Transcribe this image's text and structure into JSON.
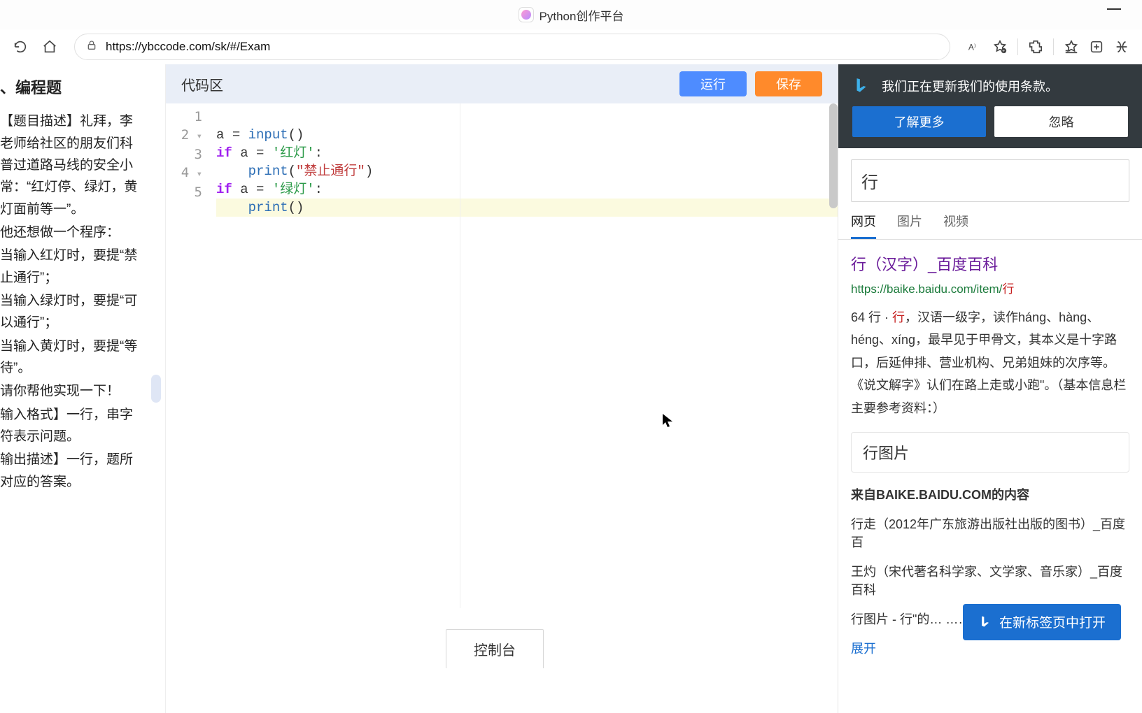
{
  "window": {
    "title": "Python创作平台"
  },
  "toolbar": {
    "url": "https://ybccode.com/sk/#/Exam"
  },
  "problem": {
    "heading": "、编程题",
    "p1": "【题目描述】礼拜，李老师给社区的朋友们科普过道路马线的安全小常：“红灯停、绿灯，黄灯面前等一”。",
    "p2": "他还想做一个程序：",
    "p3": "当输入红灯时，要提“禁止通行”；",
    "p4": "当输入绿灯时，要提“可以通行”；",
    "p5": "当输入黄灯时，要提“等待”。",
    "p6": "请你帮他实现一下！",
    "p7": "输入格式】一行，串字符表示问题。",
    "p8": "输出描述】一行，题所对应的答案。"
  },
  "editor": {
    "area_label": "代码区",
    "run_label": "运行",
    "save_label": "保存",
    "console_tab": "控制台",
    "code": {
      "l1_a": "a ",
      "l1_b": "= ",
      "l1_c": "input",
      "l1_d": "()",
      "l2_a": "if",
      "l2_b": " a ",
      "l2_c": "= ",
      "l2_d": "'红灯'",
      "l2_e": ":",
      "l3_a": "    ",
      "l3_b": "print",
      "l3_c": "(",
      "l3_d": "\"禁止通行\"",
      "l3_e": ")",
      "l4_a": "if",
      "l4_b": " a ",
      "l4_c": "= ",
      "l4_d": "'绿灯'",
      "l4_e": ":",
      "l5_a": "    ",
      "l5_b": "print",
      "l5_c": "()"
    },
    "line_numbers": [
      "1",
      "2",
      "3",
      "4",
      "5"
    ]
  },
  "bing": {
    "terms_text": "我们正在更新我们的使用条款。",
    "learn_more": "了解更多",
    "ignore": "忽略",
    "query": "行",
    "tabs": {
      "web": "网页",
      "image": "图片",
      "video": "视频"
    },
    "result": {
      "title": "行（汉字）_百度百科",
      "url_prefix": "https://baike.baidu.com/item/",
      "url_hl": "行"
    },
    "snippet_p1a": "64 行 · ",
    "snippet_hl": "行",
    "snippet_p1b": "，汉语一级字，读作háng、hàng、héng、xíng，最早见于甲骨文，其本义是十字路口，后延伸排、营业机构、兄弟姐妹的次序等。《说文解字》认们在路上走或小跑\"。（基本信息栏主要参考资料：）",
    "card": "行图片",
    "from_label": "来自BAIKE.BAIDU.COM的内容",
    "link1": "行走（2012年广东旅游出版社出版的图书）_百度百",
    "link2": "王灼（宋代著名科学家、文学家、音乐家）_百度百科",
    "link3": "行图片 - 行\"的… …… 、小篆、隶书、楷书等",
    "expand": "展开",
    "open_new": "在新标签页中打开"
  }
}
